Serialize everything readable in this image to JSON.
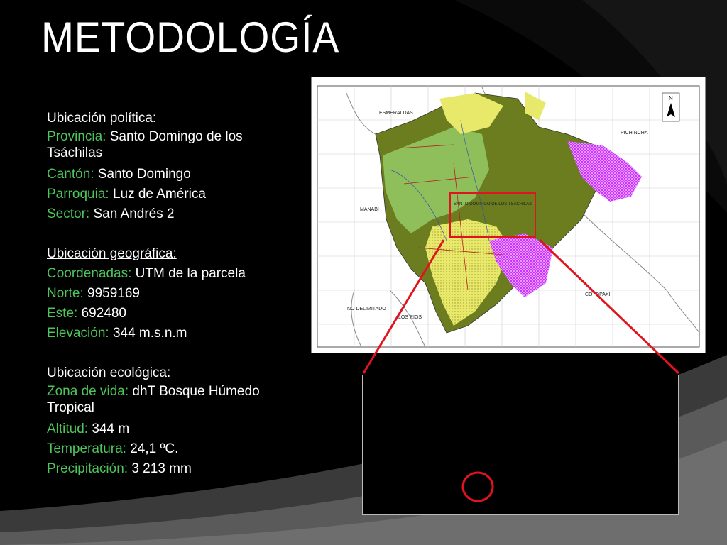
{
  "slide": {
    "title": "METODOLOGÍA"
  },
  "political": {
    "heading": "Ubicación política:",
    "items": [
      {
        "label": "Provincia:",
        "value": " Santo Domingo de los Tsáchilas"
      },
      {
        "label": "Cantón:",
        "value": " Santo Domingo"
      },
      {
        "label": "Parroquia:",
        "value": " Luz de América"
      },
      {
        "label": "Sector:",
        "value": " San Andrés 2"
      }
    ]
  },
  "geographic": {
    "heading": "Ubicación geográfica:",
    "items": [
      {
        "label": "Coordenadas:",
        "value": " UTM de la parcela"
      },
      {
        "label": "Norte:",
        "value": " 9959169"
      },
      {
        "label": "Este:",
        "value": " 692480"
      },
      {
        "label": "Elevación:",
        "value": " 344 m.s.n.m"
      }
    ]
  },
  "ecological": {
    "heading": "Ubicación ecológica:",
    "items": [
      {
        "label": "Zona de vida:",
        "value": " dhT Bosque Húmedo Tropical"
      },
      {
        "label": "Altitud:",
        "value": " 344 m"
      },
      {
        "label": "Temperatura:",
        "value": " 24,1 ºC."
      },
      {
        "label": "Precipitación:",
        "value": " 3 213 mm"
      }
    ]
  },
  "map": {
    "labels": {
      "esmeraldas": "ESMERALDAS",
      "pichincha": "PICHINCHA",
      "manabi": "MANABI",
      "cotopaxi": "COTOPAXI",
      "no_delimitado": "NO DELIMITADO",
      "los_rios": "LOS RIOS",
      "santo_domingo": "SANTO DOMINGO DE LOS TSACHILAS",
      "north": "N"
    }
  },
  "colors": {
    "label_green": "#4cc55a",
    "highlight_red": "#e0141e",
    "map_olive": "#6b7d1e",
    "map_yellow": "#e8e86a",
    "map_magenta": "#cc33ff"
  }
}
